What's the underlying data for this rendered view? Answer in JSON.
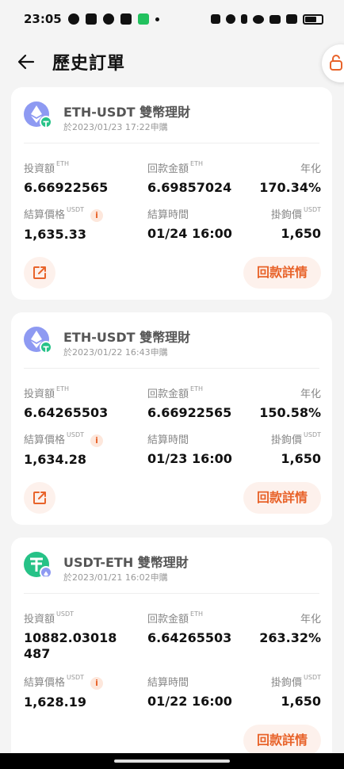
{
  "status": {
    "time": "23:05"
  },
  "header": {
    "title": "歷史訂單"
  },
  "orders": [
    {
      "name": "ETH-USDT 雙幣理財",
      "date": "於2023/01/23 17:22申購",
      "invest_label": "投資額",
      "invest_unit": "ETH",
      "invest": "6.66922565",
      "refund_label": "回款金額",
      "refund_unit": "ETH",
      "refund": "6.69857024",
      "apy_label": "年化",
      "apy": "170.34%",
      "settle_price_label": "結算價格",
      "settle_price_unit": "USDT",
      "settle_price": "1,635.33",
      "settle_time_label": "結算時間",
      "settle_time": "01/24 16:00",
      "hook_label": "掛鉤價",
      "hook_unit": "USDT",
      "hook": "1,650",
      "detail": "回款詳情"
    },
    {
      "name": "ETH-USDT 雙幣理財",
      "date": "於2023/01/22 16:43申購",
      "invest_label": "投資額",
      "invest_unit": "ETH",
      "invest": "6.64265503",
      "refund_label": "回款金額",
      "refund_unit": "ETH",
      "refund": "6.66922565",
      "apy_label": "年化",
      "apy": "150.58%",
      "settle_price_label": "結算價格",
      "settle_price_unit": "USDT",
      "settle_price": "1,634.28",
      "settle_time_label": "結算時間",
      "settle_time": "01/23 16:00",
      "hook_label": "掛鉤價",
      "hook_unit": "USDT",
      "hook": "1,650",
      "detail": "回款詳情"
    },
    {
      "name": "USDT-ETH 雙幣理財",
      "date": "於2023/01/21 16:02申購",
      "invest_label": "投資額",
      "invest_unit": "USDT",
      "invest": "10882.03018",
      "invest_line2": "487",
      "refund_label": "回款金額",
      "refund_unit": "ETH",
      "refund": "6.64265503",
      "apy_label": "年化",
      "apy": "263.32%",
      "settle_price_label": "結算價格",
      "settle_price_unit": "USDT",
      "settle_price": "1,628.19",
      "settle_time_label": "結算時間",
      "settle_time": "01/22 16:00",
      "hook_label": "掛鉤價",
      "hook_unit": "USDT",
      "hook": "1,650",
      "detail": "回款詳情"
    }
  ],
  "colors": {
    "accent": "#e8632a",
    "accent_bg": "#fdf1ec",
    "eth": "#8e9af2",
    "usdt": "#26c287"
  }
}
